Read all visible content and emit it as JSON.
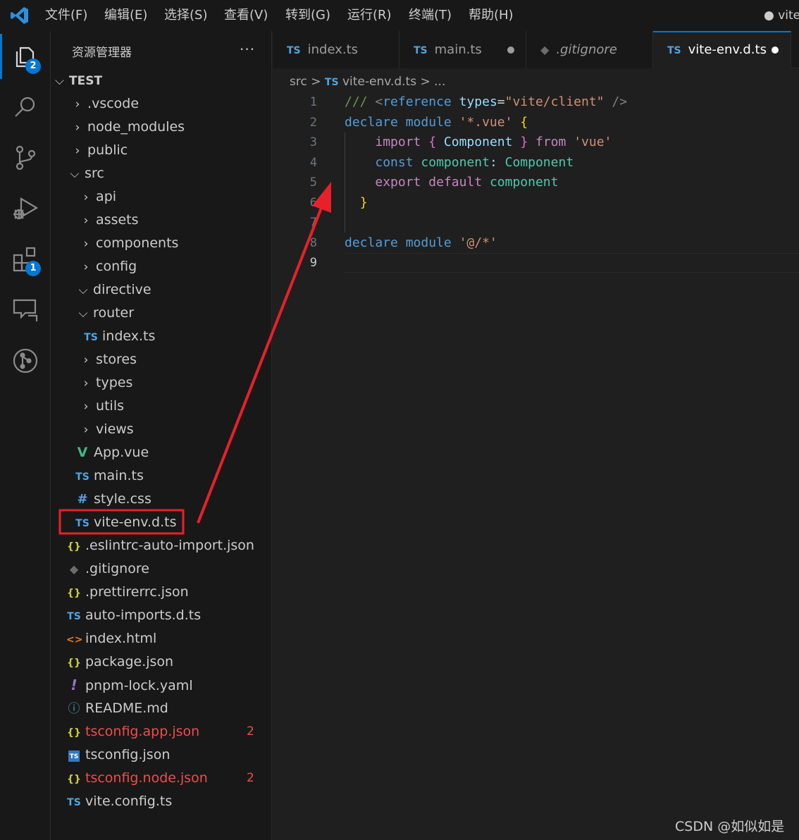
{
  "menu": [
    "文件(F)",
    "编辑(E)",
    "选择(S)",
    "查看(V)",
    "转到(G)",
    "运行(R)",
    "终端(T)",
    "帮助(H)"
  ],
  "window_title": "● vite-",
  "activity": {
    "explorer_badge": "2",
    "extensions_badge": "1"
  },
  "explorer": {
    "title": "资源管理器",
    "more": "···",
    "workspace": "TEST",
    "items": [
      {
        "label": ".vscode",
        "type": "folder",
        "expanded": false
      },
      {
        "label": "node_modules",
        "type": "folder",
        "expanded": false
      },
      {
        "label": "public",
        "type": "folder",
        "expanded": false
      },
      {
        "label": "src",
        "type": "folder",
        "expanded": true
      },
      {
        "label": "api",
        "type": "folder",
        "expanded": false
      },
      {
        "label": "assets",
        "type": "folder",
        "expanded": false
      },
      {
        "label": "components",
        "type": "folder",
        "expanded": false
      },
      {
        "label": "config",
        "type": "folder",
        "expanded": false
      },
      {
        "label": "directive",
        "type": "folder",
        "expanded": true
      },
      {
        "label": "router",
        "type": "folder",
        "expanded": true
      },
      {
        "label": "index.ts",
        "type": "ts"
      },
      {
        "label": "stores",
        "type": "folder",
        "expanded": false
      },
      {
        "label": "types",
        "type": "folder",
        "expanded": false
      },
      {
        "label": "utils",
        "type": "folder",
        "expanded": false
      },
      {
        "label": "views",
        "type": "folder",
        "expanded": false
      },
      {
        "label": "App.vue",
        "type": "vue"
      },
      {
        "label": "main.ts",
        "type": "ts"
      },
      {
        "label": "style.css",
        "type": "css"
      },
      {
        "label": "vite-env.d.ts",
        "type": "ts"
      },
      {
        "label": ".eslintrc-auto-import.json",
        "type": "json"
      },
      {
        "label": ".gitignore",
        "type": "git"
      },
      {
        "label": ".prettirerrc.json",
        "type": "json"
      },
      {
        "label": "auto-imports.d.ts",
        "type": "ts"
      },
      {
        "label": "index.html",
        "type": "html"
      },
      {
        "label": "package.json",
        "type": "json"
      },
      {
        "label": "pnpm-lock.yaml",
        "type": "yaml"
      },
      {
        "label": "README.md",
        "type": "info"
      },
      {
        "label": "tsconfig.app.json",
        "type": "json",
        "errors": "2"
      },
      {
        "label": "tsconfig.json",
        "type": "tsconfig"
      },
      {
        "label": "tsconfig.node.json",
        "type": "json",
        "errors": "2"
      },
      {
        "label": "vite.config.ts",
        "type": "ts"
      }
    ]
  },
  "tabs": [
    {
      "label": "index.ts",
      "icon": "TS",
      "modified": false,
      "active": false
    },
    {
      "label": "main.ts",
      "icon": "TS",
      "modified": true,
      "active": false
    },
    {
      "label": ".gitignore",
      "icon": "git",
      "modified": false,
      "active": false
    },
    {
      "label": "vite-env.d.ts",
      "icon": "TS",
      "modified": true,
      "active": true
    }
  ],
  "breadcrumb": {
    "folder": "src",
    "sep": ">",
    "file_icon": "TS",
    "file": "vite-env.d.ts",
    "more": "..."
  },
  "editor": {
    "line_numbers": [
      "1",
      "2",
      "3",
      "4",
      "5",
      "6",
      "7",
      "8",
      "9"
    ],
    "active_line": "9",
    "lines": [
      "/// <reference types=\"vite/client\" />",
      "declare module '*.vue' {",
      "    import { Component } from 'vue'",
      "    const component: Component",
      "    export default component",
      "  }",
      "",
      "declare module '@/*'",
      ""
    ]
  },
  "icons": {
    "ts_label": "TS",
    "css_label": "#",
    "json_label": "{}",
    "html_label": "<>",
    "yaml_label": "!",
    "info_label": "ⓘ",
    "vue_label": "V"
  },
  "colors": {
    "accent": "#0078d4",
    "error": "#f14c4c",
    "annotation": "#e8202a"
  },
  "watermark": "CSDN @如似如是"
}
